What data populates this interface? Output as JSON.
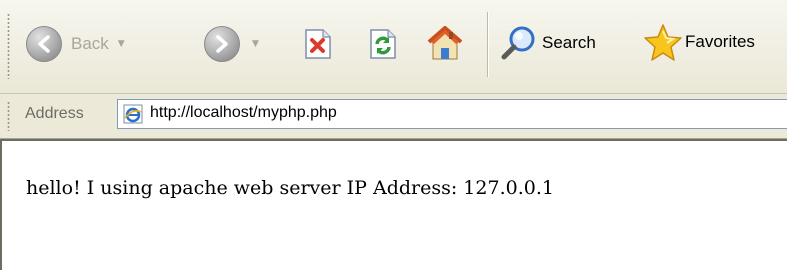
{
  "toolbar": {
    "back_label": "Back",
    "search_label": "Search",
    "favorites_label": "Favorites"
  },
  "address_bar": {
    "label": "Address",
    "url": "http://localhost/myphp.php"
  },
  "page": {
    "body_text": "hello! I using apache web server IP Address: 127.0.0.1"
  },
  "icons": [
    "back-icon",
    "forward-icon",
    "stop-icon",
    "refresh-icon",
    "home-icon",
    "search-icon",
    "favorites-icon",
    "ie-page-icon"
  ],
  "colors": {
    "toolbar_bg": "#ece9d8",
    "address_border": "#7f9db9",
    "stop_red": "#d93a2b",
    "refresh_green": "#2f9a3a",
    "star_yellow": "#f7c51c"
  }
}
